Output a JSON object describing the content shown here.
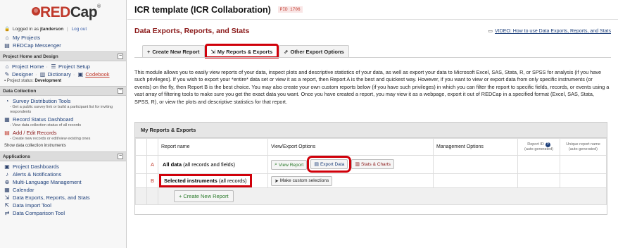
{
  "sidebar": {
    "logo": {
      "part1": "RED",
      "part2": "Cap"
    },
    "logged_in": {
      "prefix": "Logged in as",
      "user": "jtanderson",
      "sep": "|",
      "logout": "Log out"
    },
    "top_links": [
      {
        "label": "My Projects",
        "icon": "home-icon"
      },
      {
        "label": "REDCap Messenger",
        "icon": "messenger-icon"
      }
    ],
    "sections": {
      "project_home": {
        "title": "Project Home and Design",
        "row1": {
          "a": "Project Home",
          "b": "Project Setup"
        },
        "row2": {
          "a": "Designer",
          "b": "Dictionary",
          "c": "Codebook"
        },
        "status_label": "Project status:",
        "status_value": "Development"
      },
      "data_collection": {
        "title": "Data Collection",
        "items": [
          {
            "label": "Survey Distribution Tools",
            "note": "- Get a public survey link or build a participant list for inviting respondents"
          },
          {
            "label": "Record Status Dashboard",
            "note": "- View data collection status of all records"
          },
          {
            "label": "Add / Edit Records",
            "note": "- Create new records or edit/view existing ones"
          }
        ],
        "show_instruments": "Show data collection instruments"
      },
      "applications": {
        "title": "Applications",
        "items": [
          "Project Dashboards",
          "Alerts & Notifications",
          "Multi-Language Management",
          "Calendar",
          "Data Exports, Reports, and Stats",
          "Data Import Tool",
          "Data Comparison Tool"
        ]
      }
    }
  },
  "header": {
    "project_title": "ICR template (ICR Collaboration)",
    "pid": "PID 1706"
  },
  "page": {
    "title": "Data Exports, Reports, and Stats",
    "video_link": "VIDEO: How to use Data Exports, Reports, and Stats",
    "tabs": [
      {
        "label": "Create New Report",
        "icon": "plus-icon",
        "active": false
      },
      {
        "label": "My Reports & Exports",
        "icon": "export-icon",
        "active": true
      },
      {
        "label": "Other Export Options",
        "icon": "external-icon",
        "active": false
      }
    ],
    "description": "This module allows you to easily view reports of your data, inspect plots and descriptive statistics of your data, as well as export your data to Microsoft Excel, SAS, Stata, R, or SPSS for analysis (if you have such privileges). If you wish to export your *entire* data set or view it as a report, then Report A is the best and quickest way. However, if you want to view or export data from only specific instruments (or events) on the fly, then Report B is the best choice. You may also create your own custom reports below (if you have such privileges) in which you can filter the report to specific fields, records, or events using a vast array of filtering tools to make sure you get the exact data you want. Once you have created a report, you may view it as a webpage, export it out of REDCap in a specified format (Excel, SAS, Stata, SPSS, R), or view the plots and descriptive statistics for that report."
  },
  "reports_panel": {
    "title": "My Reports & Exports",
    "columns": {
      "name": "Report name",
      "view": "View/Export Options",
      "mgmt": "Management Options",
      "report_id": "Report ID",
      "auto1": "(auto-generated)",
      "unique": "Unique report name",
      "auto2": "(auto-generated)"
    },
    "rows": [
      {
        "letter": "A",
        "name_bold": "All data",
        "name_rest": " (all records and fields)"
      },
      {
        "letter": "B",
        "name_bold": "Selected instruments",
        "name_rest": " (all records)"
      }
    ],
    "buttons": {
      "view_report": "View Report",
      "export_data": "Export Data",
      "stats_charts": "Stats & Charts",
      "custom_selections": "Make custom selections",
      "create_new": "Create New Report"
    }
  }
}
